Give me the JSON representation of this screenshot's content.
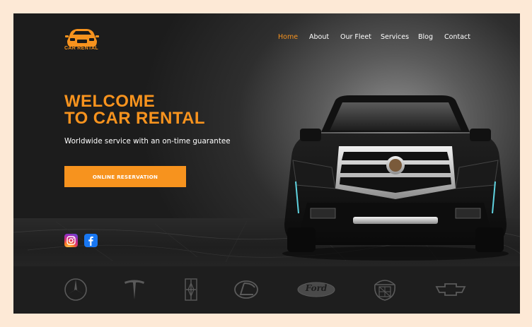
{
  "brand": {
    "name": "CAR RENTAL",
    "accent": "#f7931e"
  },
  "nav": {
    "items": [
      {
        "label": "Home",
        "active": true
      },
      {
        "label": "About",
        "active": false
      },
      {
        "label": "Our Fleet",
        "active": false
      },
      {
        "label": "Services",
        "active": false
      },
      {
        "label": "Blog",
        "active": false
      },
      {
        "label": "Contact",
        "active": false
      }
    ]
  },
  "hero": {
    "headline_line1": "WELCOME",
    "headline_line2": "TO CAR RENTAL",
    "tagline": "Worldwide service with an on-time guarantee",
    "cta_label": "ONLINE RESERVATION"
  },
  "social": {
    "icons": [
      "instagram-icon",
      "facebook-icon"
    ]
  },
  "brands": {
    "logos": [
      "mercedes-benz-logo",
      "tesla-logo",
      "lincoln-logo",
      "lexus-logo",
      "ford-logo",
      "cadillac-logo",
      "chevrolet-logo"
    ],
    "ford_wordmark": "Ford"
  },
  "colors": {
    "page_bg": "#fde9d6",
    "frame_bg": "#1a1a1a",
    "accent": "#f7931e",
    "text": "#ffffff",
    "brand_logo": "#5a5a5a"
  }
}
